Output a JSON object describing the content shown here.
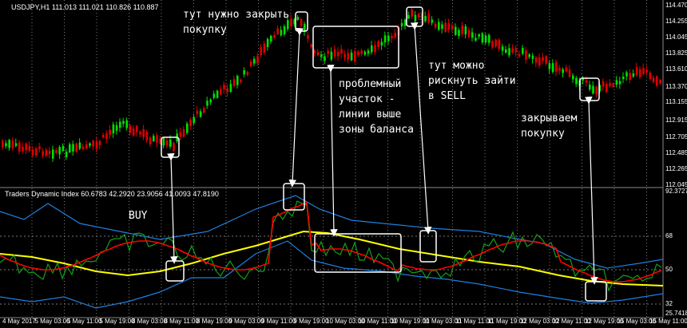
{
  "main_chart": {
    "symbol_ohlc": "USDJPY,H1  111.013 111.021 110.826 110.887",
    "price_ticks": [
      "114.470",
      "114.255",
      "114.045",
      "113.825",
      "113.610",
      "113.370",
      "113.155",
      "112.915",
      "112.705",
      "112.485",
      "112.265",
      "112.045"
    ]
  },
  "indicator": {
    "title": "Traders Dynamic Index 60.6783 42.2920 23.9056 41.0093 47.8190",
    "level_ticks": [
      "92.3727",
      "68",
      "50",
      "32",
      "25.7418"
    ]
  },
  "time_axis": [
    "4 May 2017",
    "5 May 03:00",
    "5 May 11:00",
    "5 May 19:00",
    "8 May 03:00",
    "8 May 11:00",
    "8 May 19:00",
    "9 May 03:00",
    "9 May 11:00",
    "9 May 19:00",
    "10 May 03:00",
    "10 May 11:00",
    "10 May 19:00",
    "11 May 03:00",
    "11 May 11:00",
    "11 May 19:00",
    "12 May 03:00",
    "12 May 11:00",
    "12 May 19:00",
    "15 May 03:00",
    "15 May 11:00"
  ],
  "annotations": {
    "close_buy": "тут нужно закрыть\nпокупку",
    "problem": "проблемный\nучасток -\nлинии выше\nзоны баланса",
    "risk_sell": "тут можно\nрискнуть зайти\nв SELL",
    "close_buy2": "закрываем\nпокупку",
    "buy": "BUY"
  },
  "colors": {
    "bull": "#00e000",
    "bear": "#e00000",
    "yellow": "#ffff00",
    "blue": "#1f7fe0",
    "green": "#14a014",
    "red": "#ff0000"
  }
}
